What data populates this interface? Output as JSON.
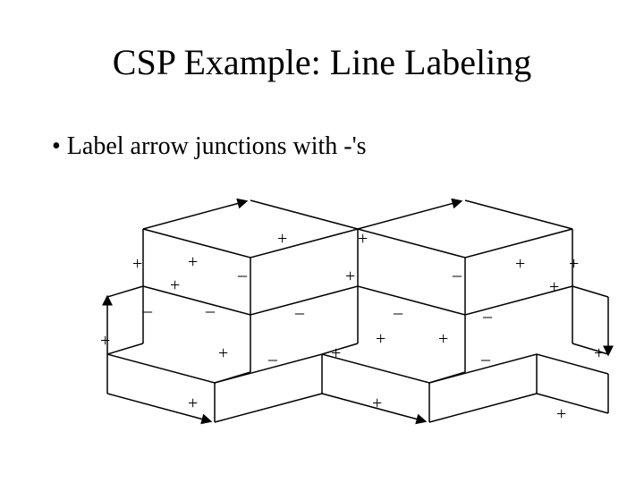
{
  "title": "CSP Example: Line Labeling",
  "bullet": "• Label arrow junctions with -'s",
  "labels": {
    "a": "+",
    "b": "+",
    "c": "+",
    "d": "+",
    "e": "_",
    "f": "+",
    "g": "_",
    "h": "+",
    "i": "+",
    "j": "+",
    "k": "+",
    "l": "_",
    "m": "_",
    "n": "_",
    "o": "_",
    "p": "_",
    "q": "+",
    "r": "+",
    "s": "_",
    "t": "+",
    "u": "+",
    "v": "_",
    "w": "+",
    "x": "+",
    "y": "+",
    "z": "+"
  }
}
